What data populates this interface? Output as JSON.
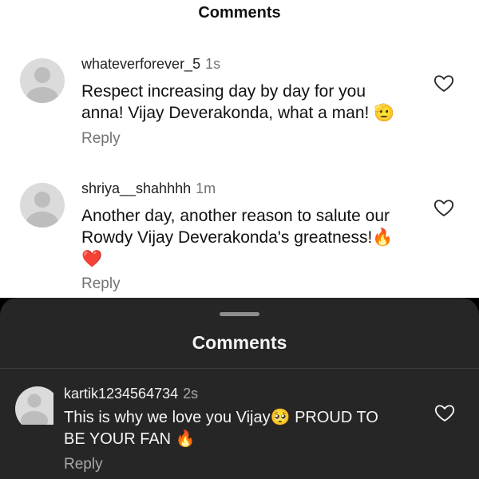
{
  "light_panel": {
    "title": "Comments",
    "comments": [
      {
        "username": "whateverforever_5",
        "time": "1s",
        "line1": "Respect increasing day by day for you",
        "line2": "anna! Vijay Deverakonda, what a man! 🫡",
        "line3": "",
        "reply": "Reply"
      },
      {
        "username": "shriya__shahhhh",
        "time": "1m",
        "line1": "Another day, another reason to salute our",
        "line2": "Rowdy Vijay Deverakonda's greatness!🔥",
        "line3": "❤️",
        "reply": "Reply"
      }
    ]
  },
  "dark_panel": {
    "title": "Comments",
    "comment": {
      "username": "kartik1234564734",
      "time": "2s",
      "line1": "This is why we love you Vijay🥺 PROUD TO",
      "line2": "BE YOUR FAN 🔥",
      "reply": "Reply"
    }
  },
  "icons": {
    "heart": "heart-outline-icon",
    "avatar": "default-avatar-icon"
  },
  "colors": {
    "light_bg": "#ffffff",
    "dark_bg": "#262626",
    "secondary_text": "#737373"
  }
}
